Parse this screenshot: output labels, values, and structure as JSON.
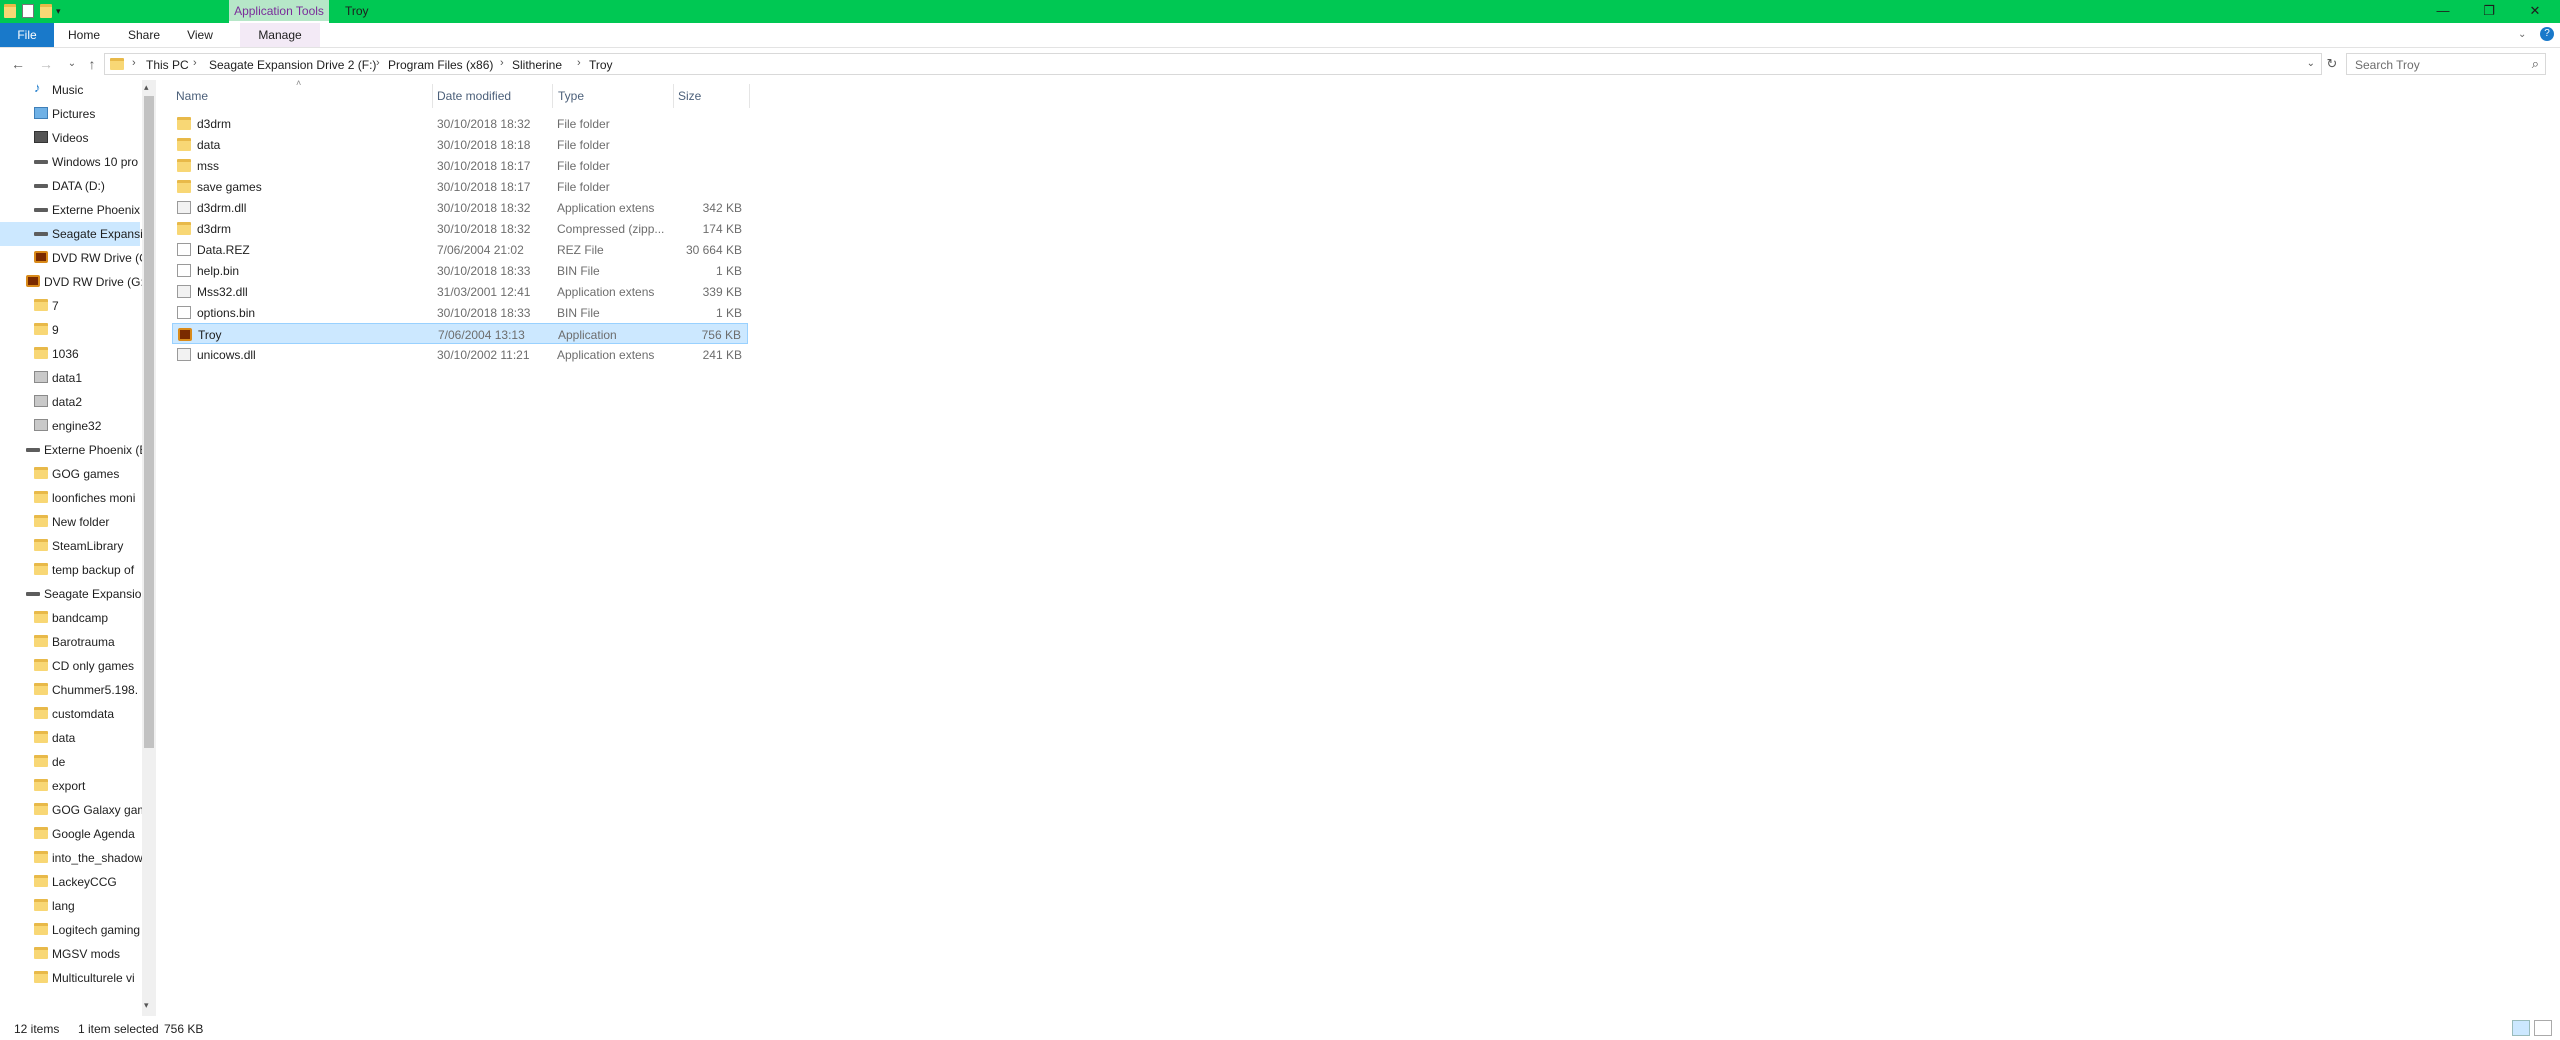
{
  "window": {
    "title": "Troy",
    "context_tab": "Application Tools"
  },
  "ribbon": {
    "tabs": [
      "File",
      "Home",
      "Share",
      "View",
      "Manage"
    ]
  },
  "breadcrumb": [
    "This PC",
    "Seagate Expansion Drive 2 (F:)",
    "Program Files (x86)",
    "Slitherine",
    "Troy"
  ],
  "search": {
    "placeholder": "Search Troy"
  },
  "nav": {
    "items": [
      {
        "label": "Music",
        "icon": "music-icon"
      },
      {
        "label": "Pictures",
        "icon": "pictures-icon"
      },
      {
        "label": "Videos",
        "icon": "videos-icon"
      },
      {
        "label": "Windows 10 pro",
        "icon": "drive-icon"
      },
      {
        "label": "DATA (D:)",
        "icon": "drive-icon"
      },
      {
        "label": "Externe Phoenix",
        "icon": "drive-icon"
      },
      {
        "label": "Seagate Expansi",
        "icon": "drive-icon",
        "selected": true
      },
      {
        "label": "DVD RW Drive (G",
        "icon": "troy-icon"
      },
      {
        "label": "DVD RW Drive (G:)",
        "icon": "troy-icon"
      },
      {
        "label": "7",
        "icon": "folder-icon"
      },
      {
        "label": "9",
        "icon": "folder-icon"
      },
      {
        "label": "1036",
        "icon": "folder-icon"
      },
      {
        "label": "data1",
        "icon": "file-icon"
      },
      {
        "label": "data2",
        "icon": "file-icon"
      },
      {
        "label": "engine32",
        "icon": "file-icon"
      },
      {
        "label": "Externe Phoenix (E",
        "icon": "drive-icon"
      },
      {
        "label": "GOG games",
        "icon": "folder-icon"
      },
      {
        "label": "loonfiches moni",
        "icon": "folder-icon"
      },
      {
        "label": "New folder",
        "icon": "folder-icon"
      },
      {
        "label": "SteamLibrary",
        "icon": "folder-icon"
      },
      {
        "label": "temp backup of",
        "icon": "folder-icon"
      },
      {
        "label": "Seagate Expansion",
        "icon": "drive-icon"
      },
      {
        "label": "bandcamp",
        "icon": "folder-icon"
      },
      {
        "label": "Barotrauma",
        "icon": "folder-icon"
      },
      {
        "label": "CD only games",
        "icon": "folder-icon"
      },
      {
        "label": "Chummer5.198.",
        "icon": "folder-icon"
      },
      {
        "label": "customdata",
        "icon": "folder-icon"
      },
      {
        "label": "data",
        "icon": "folder-icon"
      },
      {
        "label": "de",
        "icon": "folder-icon"
      },
      {
        "label": "export",
        "icon": "folder-icon"
      },
      {
        "label": "GOG Galaxy gam",
        "icon": "folder-icon"
      },
      {
        "label": "Google Agenda",
        "icon": "folder-icon"
      },
      {
        "label": "into_the_shadow",
        "icon": "folder-icon"
      },
      {
        "label": "LackeyCCG",
        "icon": "folder-icon"
      },
      {
        "label": "lang",
        "icon": "folder-icon"
      },
      {
        "label": "Logitech gaming",
        "icon": "folder-icon"
      },
      {
        "label": "MGSV mods",
        "icon": "folder-icon"
      },
      {
        "label": "Multiculturele vi",
        "icon": "folder-icon"
      }
    ]
  },
  "columns": [
    "Name",
    "Date modified",
    "Type",
    "Size"
  ],
  "files": [
    {
      "name": "d3drm",
      "date": "30/10/2018 18:32",
      "type": "File folder",
      "size": "",
      "icon": "folder-icon"
    },
    {
      "name": "data",
      "date": "30/10/2018 18:18",
      "type": "File folder",
      "size": "",
      "icon": "folder-icon"
    },
    {
      "name": "mss",
      "date": "30/10/2018 18:17",
      "type": "File folder",
      "size": "",
      "icon": "folder-icon"
    },
    {
      "name": "save games",
      "date": "30/10/2018 18:17",
      "type": "File folder",
      "size": "",
      "icon": "folder-icon"
    },
    {
      "name": "d3drm.dll",
      "date": "30/10/2018 18:32",
      "type": "Application extens",
      "size": "342 KB",
      "icon": "dll-icon"
    },
    {
      "name": "d3drm",
      "date": "30/10/2018 18:32",
      "type": "Compressed (zipp...",
      "size": "174 KB",
      "icon": "zip-icon"
    },
    {
      "name": "Data.REZ",
      "date": "7/06/2004 21:02",
      "type": "REZ File",
      "size": "30 664 KB",
      "icon": "file-icon"
    },
    {
      "name": "help.bin",
      "date": "30/10/2018 18:33",
      "type": "BIN File",
      "size": "1 KB",
      "icon": "file-icon"
    },
    {
      "name": "Mss32.dll",
      "date": "31/03/2001 12:41",
      "type": "Application extens",
      "size": "339 KB",
      "icon": "dll-icon"
    },
    {
      "name": "options.bin",
      "date": "30/10/2018 18:33",
      "type": "BIN File",
      "size": "1 KB",
      "icon": "file-icon"
    },
    {
      "name": "Troy",
      "date": "7/06/2004 13:13",
      "type": "Application",
      "size": "756 KB",
      "icon": "troy-icon",
      "selected": true
    },
    {
      "name": "unicows.dll",
      "date": "30/10/2002 11:21",
      "type": "Application extens",
      "size": "241 KB",
      "icon": "dll-icon"
    }
  ],
  "status": {
    "items": "12 items",
    "selected": "1 item selected",
    "size": "756 KB"
  },
  "colors": {
    "titlebar": "#00c853",
    "selection": "#cce8ff",
    "file_tab": "#1979ca"
  }
}
